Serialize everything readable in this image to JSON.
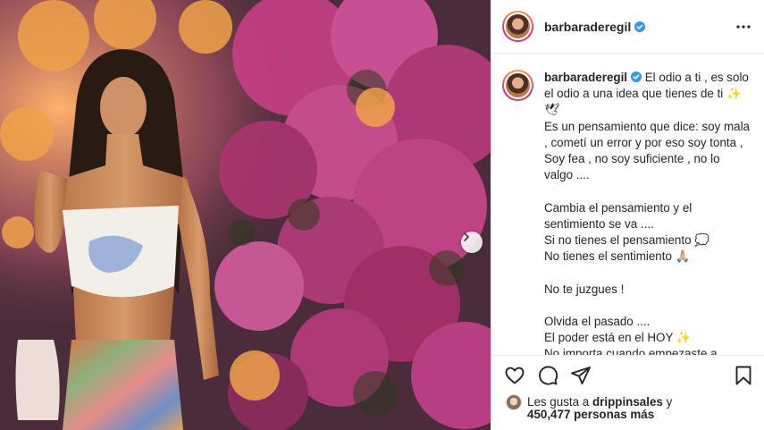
{
  "post": {
    "username": "barbaraderegil",
    "verified": true
  },
  "caption": {
    "username": "barbaraderegil",
    "text": " El odio a ti , es solo el odio a una idea que tienes de ti ✨🕊\nEs un pensamiento que dice: soy mala , cometí un error y por eso soy tonta , Soy fea , no soy suficiente , no lo valgo ....\n\nCambia el pensamiento y el sentimiento se va ....\nSi no tienes el pensamiento 💭\nNo tienes el sentimiento 🙏🏼\n\nNo te juzgues !\n\nOlvida el pasado ....\nEl poder está en el HOY ✨\nNo importa cuando empezaste a juzgarte .... Siempre puedes empezar de nuevo ...."
  },
  "likes": {
    "prefix": "Les gusta a ",
    "liker": "drippinsales",
    "connector": " y",
    "count_text": "450,477 personas más"
  },
  "icons": {
    "like": "heart-icon",
    "comment": "comment-icon",
    "share": "share-icon",
    "save": "bookmark-icon",
    "more": "more-options-icon",
    "next": "chevron-right-icon",
    "verified": "verified-badge-icon"
  },
  "colors": {
    "text": "#262626",
    "verified": "#3897f0",
    "border": "#efefef",
    "story_ring_start": "#f9a23a",
    "story_ring_end": "#c23590"
  }
}
